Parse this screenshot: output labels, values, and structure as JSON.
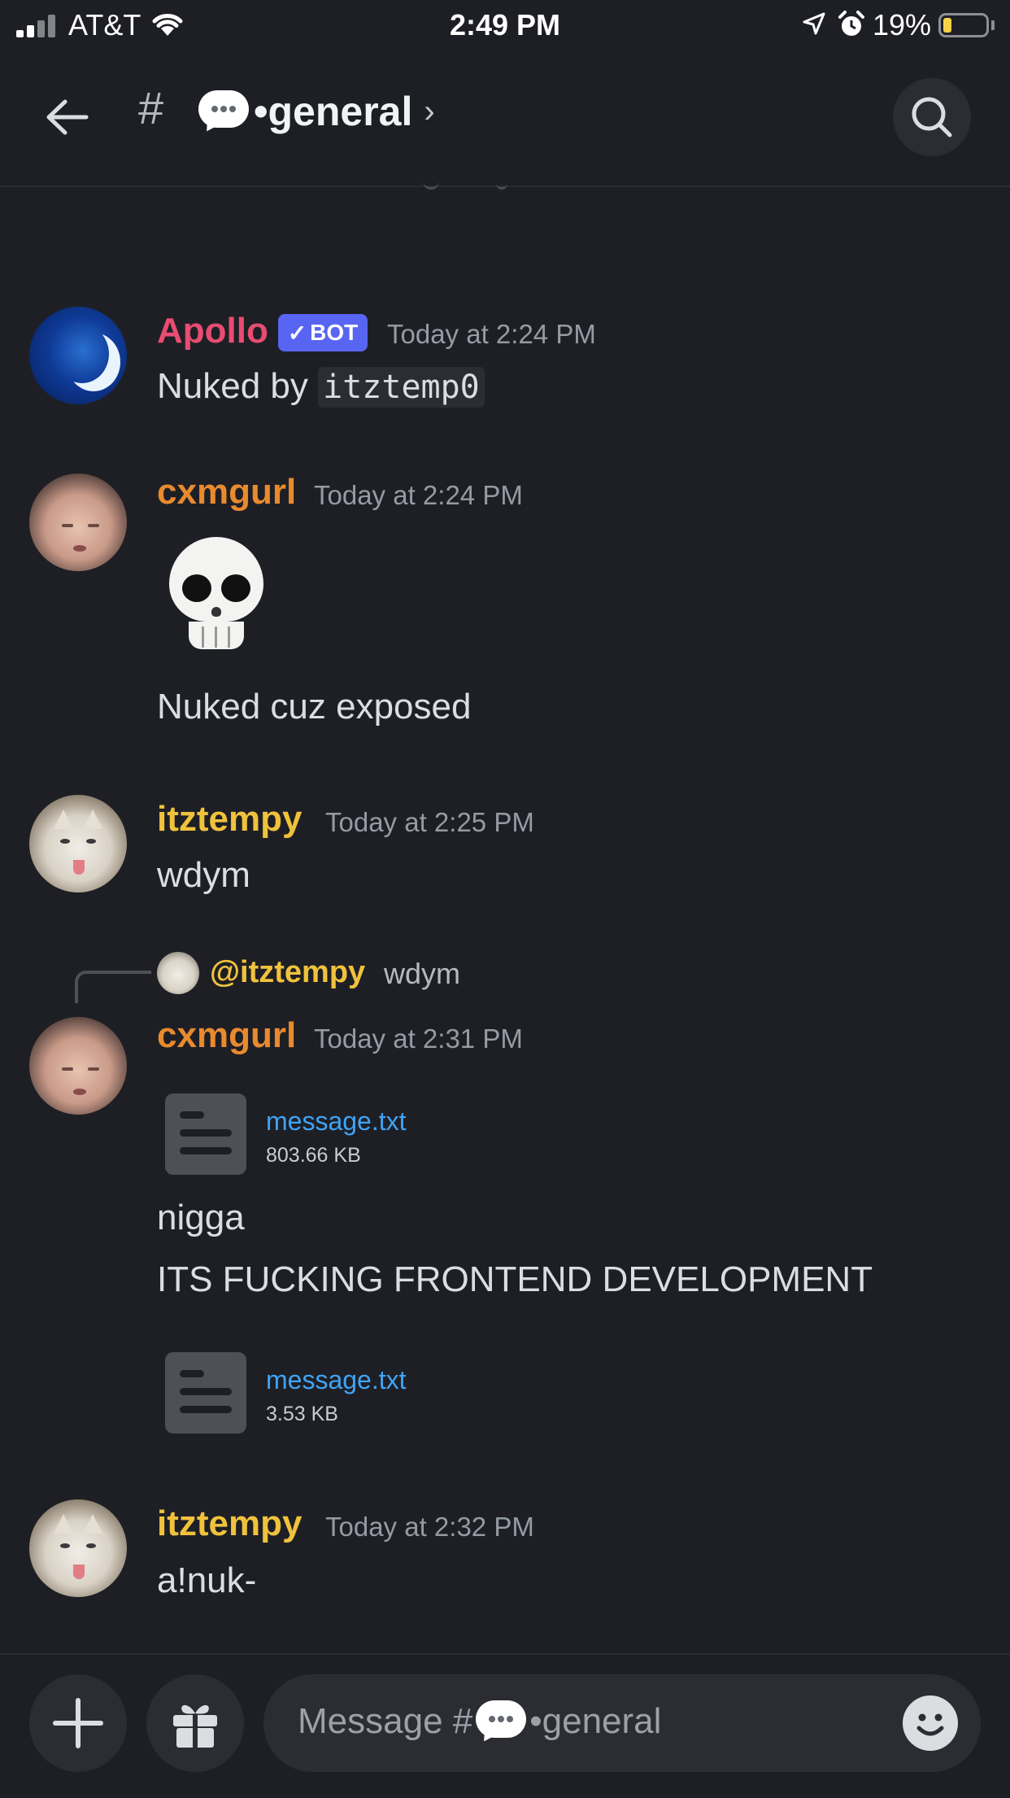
{
  "status_bar": {
    "carrier": "AT&T",
    "time": "2:49 PM",
    "battery": "19%",
    "battery_level": 0.19,
    "battery_color": "#f7d247"
  },
  "header": {
    "channel_prefix": "#",
    "channel_name": "•general",
    "chevron": "›",
    "back_icon": "back-arrow-icon",
    "search_icon": "search-icon"
  },
  "messages": [
    {
      "author": "Apollo",
      "author_color": "#e84c72",
      "badge": "BOT",
      "timestamp": "Today at 2:24 PM",
      "text_prefix": "Nuked by ",
      "code": "itztemp0"
    },
    {
      "author": "cxmgurl",
      "author_color": "#e98a2f",
      "timestamp": "Today at 2:24 PM",
      "emoji": "💀",
      "text": "Nuked cuz exposed"
    },
    {
      "author": "itztempy",
      "author_color": "#f0c23c",
      "timestamp": "Today at 2:25 PM",
      "text": "wdym"
    },
    {
      "reply": {
        "mention": "@itztempy",
        "text": "wdym"
      },
      "author": "cxmgurl",
      "author_color": "#e98a2f",
      "timestamp": "Today at 2:31 PM",
      "attachment1": {
        "name": "message.txt",
        "size": "803.66 KB"
      },
      "line1": "nigga",
      "line2": "ITS FUCKING FRONTEND DEVELOPMENT",
      "attachment2": {
        "name": "message.txt",
        "size": "3.53 KB"
      }
    },
    {
      "author": "itztempy",
      "author_color": "#f0c23c",
      "timestamp": "Today at 2:32 PM",
      "text": "a!nuk-"
    }
  ],
  "composer": {
    "placeholder_prefix": "Message #",
    "placeholder_channel": "•general",
    "add_icon": "plus-icon",
    "gift_icon": "gift-icon",
    "emoji_icon": "emoji-smile-icon"
  }
}
